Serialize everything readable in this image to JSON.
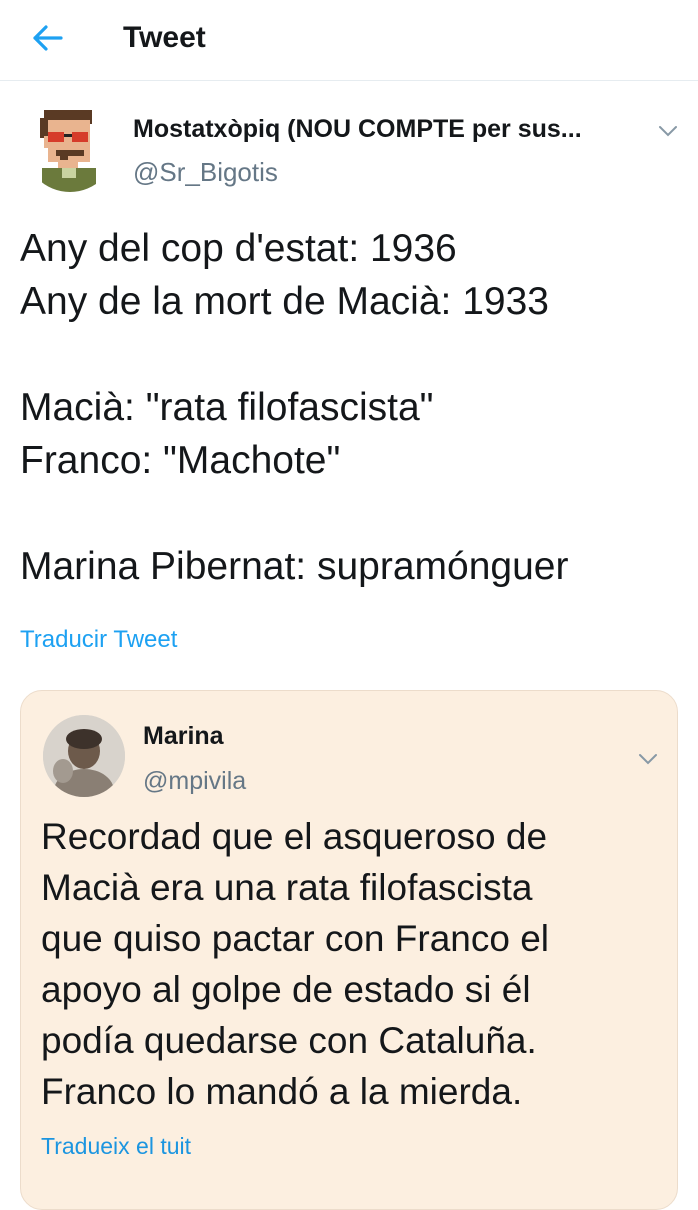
{
  "header": {
    "title": "Tweet",
    "back_icon": "arrow-left-icon",
    "accent_color": "#1da1f2"
  },
  "tweet": {
    "author_name": "Mostatxòpiq (NOU COMPTE per sus...",
    "author_handle": "@Sr_Bigotis",
    "lines": [
      "Any del cop d'estat: 1936",
      "Any de la mort de Macià: 1933",
      "",
      "Macià: \"rata filofascista\"",
      "Franco: \"Machote\"",
      "",
      "Marina Pibernat: supramónguer"
    ],
    "translate_label": "Traducir Tweet"
  },
  "quoted_tweet": {
    "author_name": "Marina",
    "author_handle": "@mpivila",
    "lines": [
      "Recordad que el asqueroso de",
      "Macià era una rata filofascista",
      "que quiso pactar con Franco el",
      "apoyo al golpe de estado si él",
      "podía quedarse con Cataluña.",
      "Franco lo mandó a la mierda."
    ],
    "translate_label": "Tradueix el tuit",
    "card_color": "#fcefe0"
  }
}
